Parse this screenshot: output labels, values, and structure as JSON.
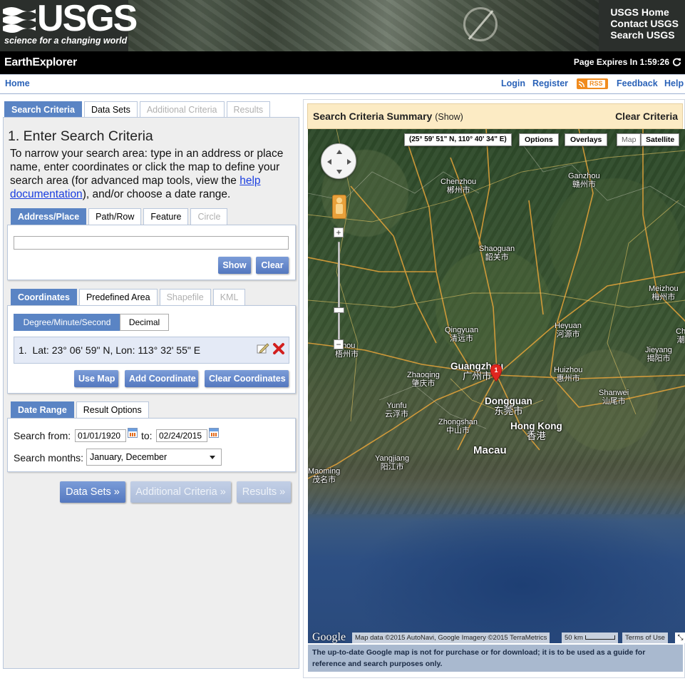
{
  "banner": {
    "logo_text": "USGS",
    "tagline": "science for a changing world",
    "links": [
      "USGS Home",
      "Contact USGS",
      "Search USGS"
    ]
  },
  "appbar": {
    "title": "EarthExplorer",
    "expires_label": "Page Expires In",
    "expires_time": "1:59:26",
    "refresh_icon": "refresh-icon"
  },
  "nav": {
    "home": "Home",
    "login": "Login",
    "register": "Register",
    "rss": "RSS",
    "feedback": "Feedback",
    "help": "Help"
  },
  "main_tabs": [
    {
      "label": "Search Criteria",
      "state": "active"
    },
    {
      "label": "Data Sets",
      "state": "normal"
    },
    {
      "label": "Additional Criteria",
      "state": "disabled"
    },
    {
      "label": "Results",
      "state": "disabled"
    }
  ],
  "step": {
    "title": "1. Enter Search Criteria",
    "intro_before": "To narrow your search area: type in an address or place name, enter coordinates or click the map to define your search area (for advanced map tools, view the ",
    "intro_link": "help documentation",
    "intro_after": "), and/or choose a date range."
  },
  "address_tabs": [
    {
      "label": "Address/Place",
      "state": "active"
    },
    {
      "label": "Path/Row",
      "state": "normal"
    },
    {
      "label": "Feature",
      "state": "normal"
    },
    {
      "label": "Circle",
      "state": "disabled"
    }
  ],
  "address": {
    "input_value": "",
    "show_button": "Show",
    "clear_button": "Clear"
  },
  "coord_tabs": [
    {
      "label": "Coordinates",
      "state": "active"
    },
    {
      "label": "Predefined Area",
      "state": "normal"
    },
    {
      "label": "Shapefile",
      "state": "disabled"
    },
    {
      "label": "KML",
      "state": "disabled"
    }
  ],
  "coord_format": {
    "dms": "Degree/Minute/Second",
    "decimal": "Decimal",
    "selected": "Degree/Minute/Second"
  },
  "coordinates": [
    {
      "index": "1.",
      "text": "Lat: 23° 06' 59\" N, Lon: 113° 32' 55\" E"
    }
  ],
  "coord_buttons": {
    "use_map": "Use Map",
    "add": "Add Coordinate",
    "clear": "Clear Coordinates"
  },
  "date_tabs": [
    {
      "label": "Date Range",
      "state": "active"
    },
    {
      "label": "Result Options",
      "state": "normal"
    }
  ],
  "date_range": {
    "from_label": "Search from:",
    "from_value": "01/01/1920",
    "to_label": "to:",
    "to_value": "02/24/2015",
    "months_label": "Search months:",
    "months_value": "January, December"
  },
  "nav_buttons": {
    "data_sets": "Data Sets »",
    "additional": "Additional Criteria »",
    "results": "Results »"
  },
  "summary": {
    "title": "Search Criteria Summary",
    "show": "(Show)",
    "clear": "Clear Criteria"
  },
  "map": {
    "cursor_coords": "(25° 59' 51\" N, 110° 40' 34\" E)",
    "options": "Options",
    "overlays": "Overlays",
    "map_type": "Map",
    "satellite": "Satellite",
    "marker_label": "1",
    "labels": [
      {
        "name": "Chenzhou",
        "native": "郴州市"
      },
      {
        "name": "Ganzhou",
        "native": "赣州市"
      },
      {
        "name": "Shaoguan",
        "native": "韶关市"
      },
      {
        "name": "Meizhou",
        "native": "梅州市"
      },
      {
        "name": "Heyuan",
        "native": "河源市"
      },
      {
        "name": "Qingyuan",
        "native": "清远市"
      },
      {
        "name": "zhou",
        "native": "梧州市"
      },
      {
        "name": "Guangzhou",
        "native": "广州市"
      },
      {
        "name": "Huizhou",
        "native": "惠州市"
      },
      {
        "name": "Jieyang",
        "native": "揭阳市"
      },
      {
        "name": "Zhaoqing",
        "native": "肇庆市"
      },
      {
        "name": "Yunfu",
        "native": "云浮市"
      },
      {
        "name": "Dongguan",
        "native": "东莞市"
      },
      {
        "name": "Shanwei",
        "native": "汕尾市"
      },
      {
        "name": "Zhongshan",
        "native": "中山市"
      },
      {
        "name": "Hong Kong",
        "native": "香港"
      },
      {
        "name": "Macau",
        "native": ""
      },
      {
        "name": "Yangjiang",
        "native": "阳江市"
      },
      {
        "name": "Maoming",
        "native": "茂名市"
      },
      {
        "name": "Ch",
        "native": "潮"
      }
    ],
    "google": "Google",
    "attribution": "Map data ©2015 AutoNavi, Google Imagery ©2015 TerraMetrics",
    "scale": "50 km",
    "terms": "Terms of Use"
  },
  "disclaimer": "The up-to-date Google map is not for purchase or for download; it is to be used as a guide for reference and search purposes only."
}
